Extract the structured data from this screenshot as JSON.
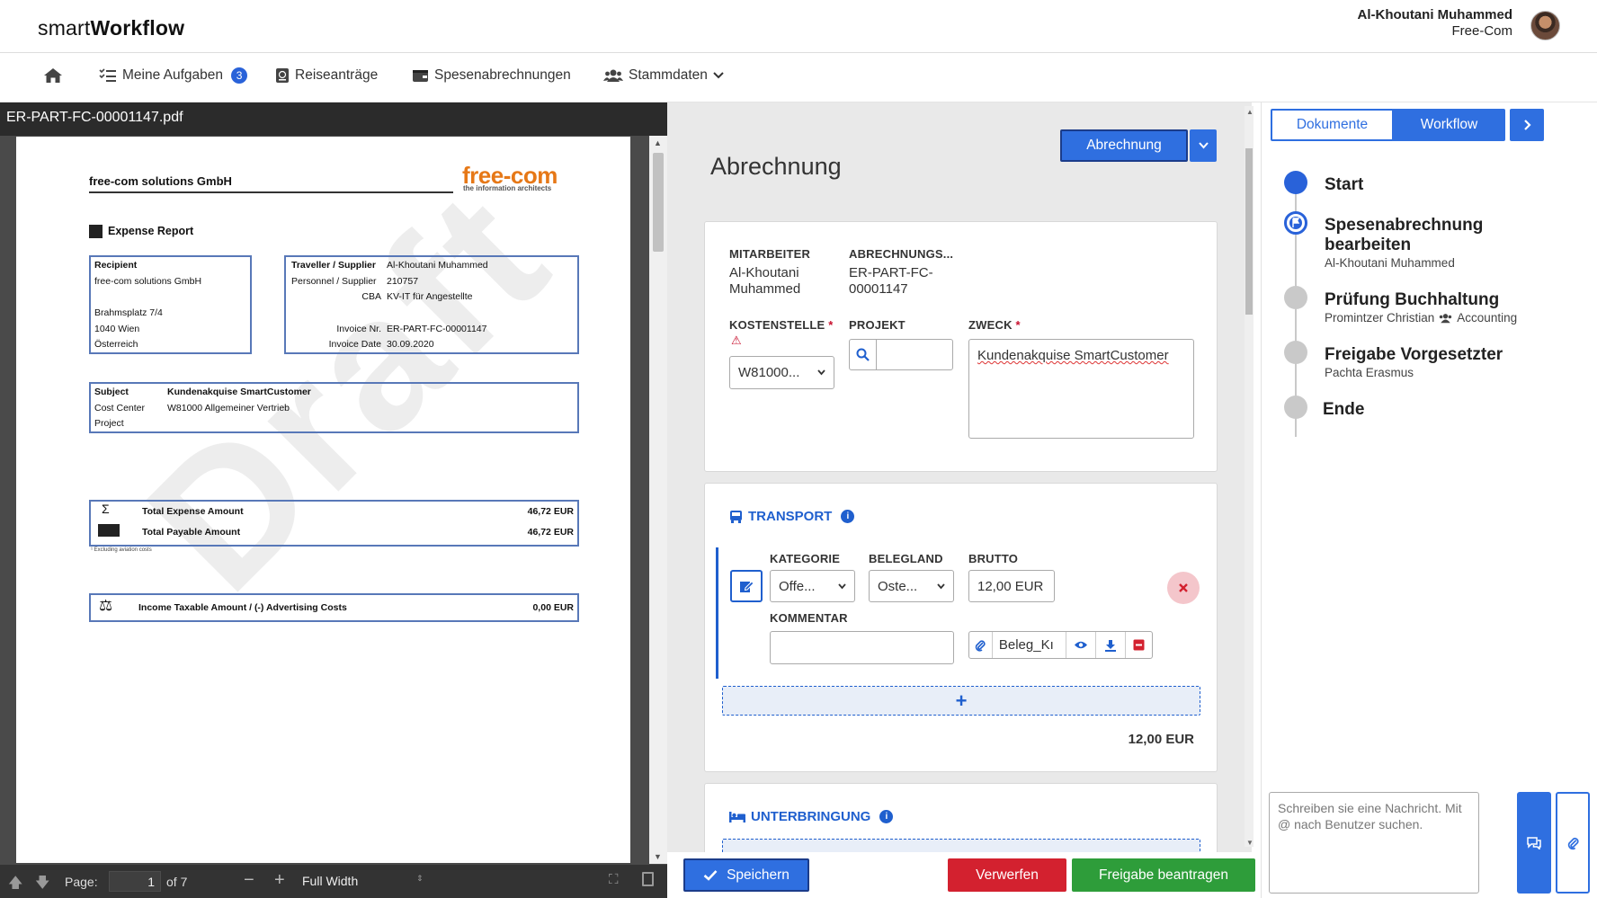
{
  "header": {
    "brand_light": "smart",
    "brand_bold": "Workflow",
    "user_name": "Al-Khoutani Muhammed",
    "user_org": "Free-Com"
  },
  "nav": {
    "tasks_label": "Meine Aufgaben",
    "tasks_count": "3",
    "travel_label": "Reiseanträge",
    "expenses_label": "Spesenabrechnungen",
    "master_label": "Stammdaten"
  },
  "pdf": {
    "filename": "ER-PART-FC-00001147.pdf",
    "company": "free-com solutions GmbH",
    "logo_main": "free-com",
    "logo_sub": "the information architects",
    "report_title": "Expense Report",
    "recipient_label": "Recipient",
    "recipient_lines": [
      "free-com solutions GmbH",
      "",
      "Brahmsplatz 7/4",
      "1040 Wien",
      "Österreich"
    ],
    "traveller_label": "Traveller / Supplier",
    "traveller_value": "Al-Khoutani Muhammed",
    "personnel_label": "Personnel / Supplier",
    "personnel_value": "210757",
    "cba_label": "CBA",
    "cba_value": "KV-IT für Angestellte",
    "invoice_nr_label": "Invoice Nr.",
    "invoice_nr_value": "ER-PART-FC-00001147",
    "invoice_date_label": "Invoice Date",
    "invoice_date_value": "30.09.2020",
    "subject_label": "Subject",
    "subject_value": "Kundenakquise SmartCustomer",
    "cost_center_label": "Cost Center",
    "cost_center_value": "W81000 Allgemeiner Vertrieb",
    "project_label": "Project",
    "total_expense_label": "Total Expense Amount",
    "total_expense_value": "46,72 EUR",
    "total_payable_label": "Total Payable Amount",
    "total_payable_value": "46,72 EUR",
    "footnote": "¹ Excluding aviation costs",
    "income_label": "Income Taxable Amount / (-) Advertising Costs",
    "income_value": "0,00 EUR",
    "watermark": "Draft",
    "page_label": "Page:",
    "page_value": "1",
    "page_total": "of 7",
    "zoom_value": "Full Width"
  },
  "form": {
    "title": "Abrechnung",
    "type_button": "Abrechnung",
    "employee_label": "Mitarbeiter",
    "employee_value": "Al-Khoutani Muhammed",
    "billing_label": "Abrechnungs...",
    "billing_value": "ER-PART-FC-00001147",
    "cost_center_label": "Kostenstelle",
    "cost_center_value": "W81000...",
    "project_label": "Projekt",
    "project_value": "",
    "purpose_label": "Zweck",
    "purpose_value": "Kundenakquise SmartCustomer",
    "transport_title": "Transport",
    "category_label": "Kategorie",
    "category_value": "Offe...",
    "country_label": "Belegland",
    "country_value": "Oste...",
    "gross_label": "Brutto",
    "gross_value": "12,00 EUR",
    "comment_label": "Kommentar",
    "comment_value": "",
    "attachment_value": "Beleg_Kı",
    "add_symbol": "+",
    "transport_total": "12,00 EUR",
    "lodging_title": "Unterbringung"
  },
  "actions": {
    "save": "Speichern",
    "discard": "Verwerfen",
    "request_approval": "Freigabe beantragen"
  },
  "workflow": {
    "tab_documents": "Dokumente",
    "tab_workflow": "Workflow",
    "steps": [
      {
        "title": "Start",
        "sub": ""
      },
      {
        "title": "Spesenabrechnung bearbeiten",
        "sub": "Al-Khoutani Muhammed"
      },
      {
        "title": "Prüfung Buchhaltung",
        "sub": "Promintzer Christian",
        "sub2": "Accounting"
      },
      {
        "title": "Freigabe Vorgesetzter",
        "sub": "Pachta Erasmus"
      },
      {
        "title": "Ende",
        "sub": ""
      }
    ],
    "message_placeholder": "Schreiben sie eine Nachricht. Mit @ nach Benutzer suchen."
  },
  "colors": {
    "accent": "#2f6fe0",
    "danger": "#d3212f",
    "success": "#2e9d3a"
  }
}
